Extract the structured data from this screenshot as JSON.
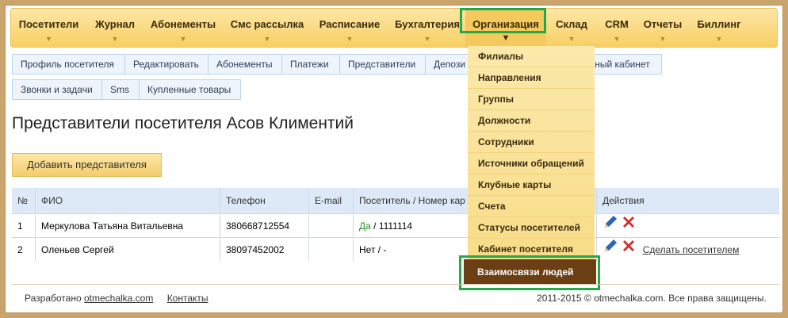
{
  "topmenu": [
    {
      "label": "Посетители"
    },
    {
      "label": "Журнал"
    },
    {
      "label": "Абонементы"
    },
    {
      "label": "Смс рассылка"
    },
    {
      "label": "Расписание"
    },
    {
      "label": "Бухгалтерия"
    },
    {
      "label": "Организация",
      "active": true
    },
    {
      "label": "Склад"
    },
    {
      "label": "CRM"
    },
    {
      "label": "Отчеты"
    },
    {
      "label": "Биллинг"
    }
  ],
  "subnav_row1": [
    "Профиль посетителя",
    "Редактировать",
    "Абонементы",
    "Платежи",
    "Представители",
    "Депози",
    "чный кабинет"
  ],
  "subnav_row2": [
    "Звонки и задачи",
    "Sms",
    "Купленные товары"
  ],
  "page_title": "Представители посетителя Асов Климентий",
  "add_button": "Добавить представителя",
  "table": {
    "headers": [
      "№",
      "ФИО",
      "Телефон",
      "E-mail",
      "Посетитель / Номер кар",
      "Действия"
    ],
    "rows": [
      {
        "num": "1",
        "name": "Меркулова Татьяна Витальевна",
        "phone": "380668712554",
        "email": "",
        "visitor_yes": "Да",
        "visitor_rest": " / 1111114",
        "make_link": ""
      },
      {
        "num": "2",
        "name": "Оленьев Сергей",
        "phone": "38097452002",
        "email": "",
        "visitor_yes": "",
        "visitor_rest": "Нет / -",
        "make_link": "Сделать посетителем"
      }
    ]
  },
  "dropdown": {
    "items": [
      "Филиалы",
      "Направления",
      "Группы",
      "Должности",
      "Сотрудники",
      "Источники обращений",
      "Клубные карты",
      "Счета",
      "Статусы посетителей",
      "Кабинет посетителя"
    ],
    "active_item": "Взаимосвязи людей"
  },
  "footer": {
    "prefix": "Разработано",
    "link": "otmechalka.com",
    "contacts": "Контакты",
    "copyright": "2011-2015 © otmechalka.com. Все права защищены."
  },
  "colors": {
    "highlight": "#25a84a",
    "menu_active_dark": "#6b3e13",
    "delete_red": "#d42b2b",
    "edit_blue": "#2f64b4"
  }
}
